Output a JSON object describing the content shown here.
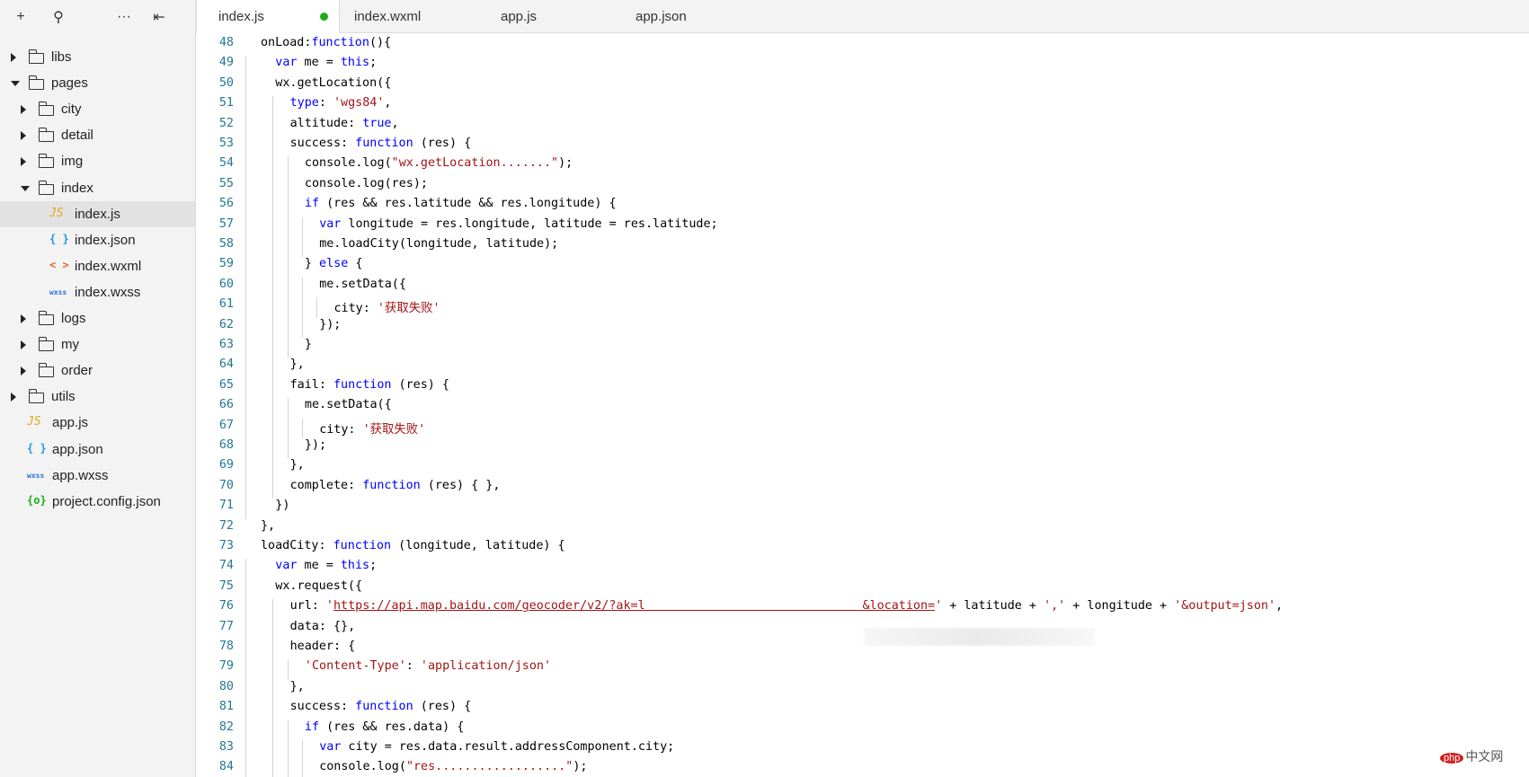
{
  "sidebar": {
    "toolbar": [
      {
        "name": "add-icon",
        "glyph": "+"
      },
      {
        "name": "search-icon",
        "glyph": "⚲"
      },
      {
        "name": "more-icon",
        "glyph": "···"
      },
      {
        "name": "collapse-panel-icon",
        "glyph": "⇤"
      }
    ],
    "tree": [
      {
        "label": "libs",
        "type": "folder",
        "depth": 0,
        "expanded": false
      },
      {
        "label": "pages",
        "type": "folder",
        "depth": 0,
        "expanded": true
      },
      {
        "label": "city",
        "type": "folder",
        "depth": 1,
        "expanded": false
      },
      {
        "label": "detail",
        "type": "folder",
        "depth": 1,
        "expanded": false
      },
      {
        "label": "img",
        "type": "folder",
        "depth": 1,
        "expanded": false
      },
      {
        "label": "index",
        "type": "folder",
        "depth": 1,
        "expanded": true
      },
      {
        "label": "index.js",
        "type": "js",
        "icon": "JS",
        "depth": 2,
        "selected": true
      },
      {
        "label": "index.json",
        "type": "json",
        "icon": "{ }",
        "depth": 2
      },
      {
        "label": "index.wxml",
        "type": "wxml",
        "icon": "< >",
        "depth": 2
      },
      {
        "label": "index.wxss",
        "type": "wxss",
        "icon": "wxss",
        "depth": 2
      },
      {
        "label": "logs",
        "type": "folder",
        "depth": 1,
        "expanded": false
      },
      {
        "label": "my",
        "type": "folder",
        "depth": 1,
        "expanded": false
      },
      {
        "label": "order",
        "type": "folder",
        "depth": 1,
        "expanded": false
      },
      {
        "label": "utils",
        "type": "folder",
        "depth": 0,
        "expanded": false
      },
      {
        "label": "app.js",
        "type": "js",
        "icon": "JS",
        "depth": 0
      },
      {
        "label": "app.json",
        "type": "json",
        "icon": "{ }",
        "depth": 0
      },
      {
        "label": "app.wxss",
        "type": "wxss",
        "icon": "wxss",
        "depth": 0
      },
      {
        "label": "project.config.json",
        "type": "config",
        "icon": "{o}",
        "depth": 0
      }
    ]
  },
  "tabs": [
    {
      "label": "index.js",
      "active": true,
      "modified": true
    },
    {
      "label": "index.wxml",
      "active": false
    },
    {
      "label": "app.js",
      "active": false
    },
    {
      "label": "app.json",
      "active": false
    }
  ],
  "editor": {
    "lines": [
      {
        "n": "48",
        "indent": 1,
        "tokens": [
          [
            "p",
            "onLoad:"
          ],
          [
            "k",
            "function"
          ],
          [
            "p",
            "(){"
          ]
        ]
      },
      {
        "n": "49",
        "indent": 2,
        "tokens": [
          [
            "k",
            "var"
          ],
          [
            "p",
            " me = "
          ],
          [
            "k",
            "this"
          ],
          [
            "p",
            ";"
          ]
        ]
      },
      {
        "n": "50",
        "indent": 2,
        "tokens": [
          [
            "p",
            "wx.getLocation({"
          ]
        ]
      },
      {
        "n": "51",
        "indent": 3,
        "tokens": [
          [
            "k",
            "type"
          ],
          [
            "p",
            ": "
          ],
          [
            "s",
            "'wgs84'"
          ],
          [
            "p",
            ","
          ]
        ]
      },
      {
        "n": "52",
        "indent": 3,
        "tokens": [
          [
            "p",
            "altitude: "
          ],
          [
            "k",
            "true"
          ],
          [
            "p",
            ","
          ]
        ]
      },
      {
        "n": "53",
        "indent": 3,
        "tokens": [
          [
            "p",
            "success: "
          ],
          [
            "k",
            "function"
          ],
          [
            "p",
            " (res) {"
          ]
        ]
      },
      {
        "n": "54",
        "indent": 4,
        "tokens": [
          [
            "p",
            "console.log("
          ],
          [
            "s",
            "\"wx.getLocation.......\""
          ],
          [
            "p",
            ");"
          ]
        ]
      },
      {
        "n": "55",
        "indent": 4,
        "tokens": [
          [
            "p",
            "console.log(res);"
          ]
        ]
      },
      {
        "n": "56",
        "indent": 4,
        "tokens": [
          [
            "k",
            "if"
          ],
          [
            "p",
            " (res && res.latitude && res.longitude) {"
          ]
        ]
      },
      {
        "n": "57",
        "indent": 5,
        "tokens": [
          [
            "k",
            "var"
          ],
          [
            "p",
            " longitude = res.longitude, latitude = res.latitude;"
          ]
        ]
      },
      {
        "n": "58",
        "indent": 5,
        "tokens": [
          [
            "p",
            "me.loadCity(longitude, latitude);"
          ]
        ]
      },
      {
        "n": "59",
        "indent": 4,
        "tokens": [
          [
            "p",
            "} "
          ],
          [
            "k",
            "else"
          ],
          [
            "p",
            " {"
          ]
        ]
      },
      {
        "n": "60",
        "indent": 5,
        "tokens": [
          [
            "p",
            "me.setData({"
          ]
        ]
      },
      {
        "n": "61",
        "indent": 6,
        "tokens": [
          [
            "p",
            "city: "
          ],
          [
            "s",
            "'获取失败'"
          ]
        ]
      },
      {
        "n": "62",
        "indent": 5,
        "tokens": [
          [
            "p",
            "});"
          ]
        ]
      },
      {
        "n": "63",
        "indent": 4,
        "tokens": [
          [
            "p",
            "}"
          ]
        ]
      },
      {
        "n": "64",
        "indent": 3,
        "tokens": [
          [
            "p",
            "},"
          ]
        ]
      },
      {
        "n": "65",
        "indent": 3,
        "tokens": [
          [
            "p",
            "fail: "
          ],
          [
            "k",
            "function"
          ],
          [
            "p",
            " (res) {"
          ]
        ]
      },
      {
        "n": "66",
        "indent": 4,
        "tokens": [
          [
            "p",
            "me.setData({"
          ]
        ]
      },
      {
        "n": "67",
        "indent": 5,
        "tokens": [
          [
            "p",
            "city: "
          ],
          [
            "s",
            "'获取失败'"
          ]
        ]
      },
      {
        "n": "68",
        "indent": 4,
        "tokens": [
          [
            "p",
            "});"
          ]
        ]
      },
      {
        "n": "69",
        "indent": 3,
        "tokens": [
          [
            "p",
            "},"
          ]
        ]
      },
      {
        "n": "70",
        "indent": 3,
        "tokens": [
          [
            "p",
            "complete: "
          ],
          [
            "k",
            "function"
          ],
          [
            "p",
            " (res) { },"
          ]
        ]
      },
      {
        "n": "71",
        "indent": 2,
        "tokens": [
          [
            "p",
            "})"
          ]
        ]
      },
      {
        "n": "72",
        "indent": 1,
        "tokens": [
          [
            "p",
            "},"
          ]
        ]
      },
      {
        "n": "73",
        "indent": 1,
        "tokens": [
          [
            "p",
            "loadCity: "
          ],
          [
            "k",
            "function"
          ],
          [
            "p",
            " (longitude, latitude) {"
          ]
        ]
      },
      {
        "n": "74",
        "indent": 2,
        "tokens": [
          [
            "k",
            "var"
          ],
          [
            "p",
            " me = "
          ],
          [
            "k",
            "this"
          ],
          [
            "p",
            ";"
          ]
        ]
      },
      {
        "n": "75",
        "indent": 2,
        "tokens": [
          [
            "p",
            "wx.request({"
          ]
        ]
      },
      {
        "n": "76",
        "indent": 3,
        "tokens": [
          [
            "p",
            "url: "
          ],
          [
            "s",
            "'"
          ],
          [
            "u",
            "https://api.map.baidu.com/geocoder/v2/?ak=l                              &location="
          ],
          [
            "s",
            "'"
          ],
          [
            "p",
            " + latitude + "
          ],
          [
            "s",
            "','"
          ],
          [
            "p",
            " + longitude + "
          ],
          [
            "s",
            "'&output=json'"
          ],
          [
            "p",
            ","
          ]
        ]
      },
      {
        "n": "77",
        "indent": 3,
        "tokens": [
          [
            "p",
            "data: {},"
          ]
        ]
      },
      {
        "n": "78",
        "indent": 3,
        "tokens": [
          [
            "p",
            "header: {"
          ]
        ]
      },
      {
        "n": "79",
        "indent": 4,
        "tokens": [
          [
            "s",
            "'Content-Type'"
          ],
          [
            "p",
            ": "
          ],
          [
            "s",
            "'application/json'"
          ]
        ]
      },
      {
        "n": "80",
        "indent": 3,
        "tokens": [
          [
            "p",
            "},"
          ]
        ]
      },
      {
        "n": "81",
        "indent": 3,
        "tokens": [
          [
            "p",
            "success: "
          ],
          [
            "k",
            "function"
          ],
          [
            "p",
            " (res) {"
          ]
        ]
      },
      {
        "n": "82",
        "indent": 4,
        "tokens": [
          [
            "k",
            "if"
          ],
          [
            "p",
            " (res && res.data) {"
          ]
        ]
      },
      {
        "n": "83",
        "indent": 5,
        "tokens": [
          [
            "k",
            "var"
          ],
          [
            "p",
            " city = res.data.result.addressComponent.city;"
          ]
        ]
      },
      {
        "n": "84",
        "indent": 5,
        "tokens": [
          [
            "p",
            "console.log("
          ],
          [
            "s",
            "\"res..................\""
          ],
          [
            "p",
            ");"
          ]
        ]
      }
    ]
  },
  "watermark": {
    "logo": "php",
    "text": "中文网"
  },
  "colors": {
    "keyword": "#0000ff",
    "string": "#a31515",
    "line_number": "#237893",
    "js_icon": "#e8a317",
    "json_icon": "#1f9ad6",
    "wxml_icon": "#e0652a",
    "wxss_icon": "#1f6fd6",
    "config_icon": "#1aad19",
    "modified_dot": "#1aad19"
  }
}
